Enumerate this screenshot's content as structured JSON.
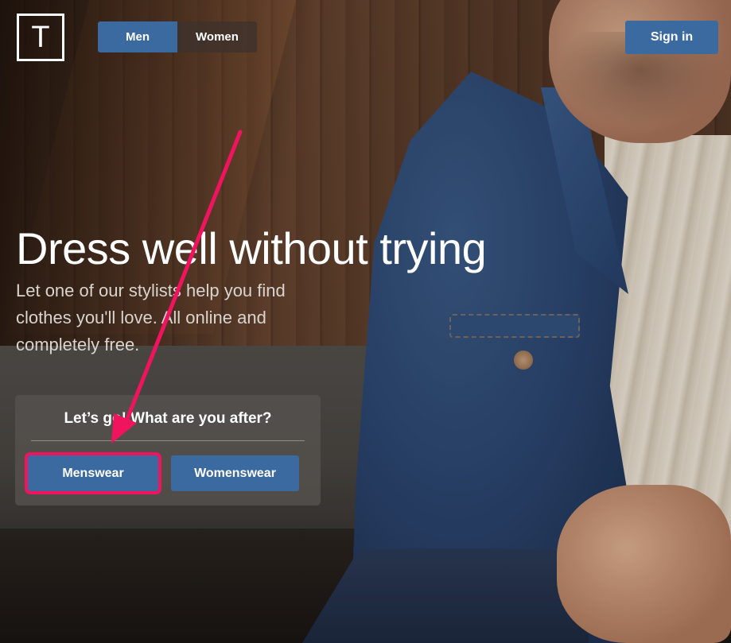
{
  "header": {
    "logo_letter": "T",
    "gender_tabs": [
      {
        "label": "Men",
        "active": true
      },
      {
        "label": "Women",
        "active": false
      }
    ],
    "signin_label": "Sign in"
  },
  "hero": {
    "title": "Dress well without trying",
    "subtitle": "Let one of our stylists help you find clothes you'll love. All online and completely free."
  },
  "cta": {
    "heading": "Let’s go! What are you after?",
    "menswear_label": "Menswear",
    "womenswear_label": "Womenswear"
  },
  "colors": {
    "accent": "#3b6aa0",
    "annotation": "#f0145f"
  }
}
